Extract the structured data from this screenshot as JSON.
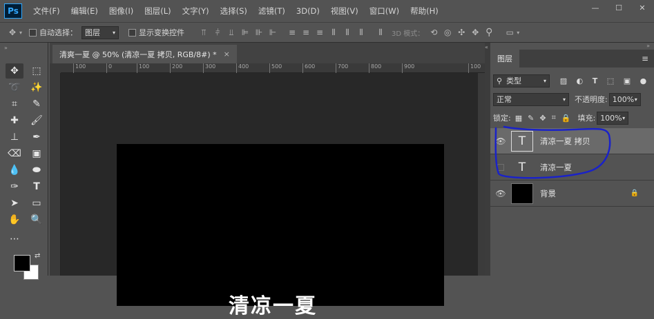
{
  "app": {
    "logo": "Ps"
  },
  "menu": [
    "文件(F)",
    "编辑(E)",
    "图像(I)",
    "图层(L)",
    "文字(Y)",
    "选择(S)",
    "滤镜(T)",
    "3D(D)",
    "视图(V)",
    "窗口(W)",
    "帮助(H)"
  ],
  "window_controls": {
    "minimize": "—",
    "maximize": "☐",
    "close": "✕"
  },
  "options": {
    "auto_select_label": "自动选择：",
    "auto_select_value": "图层",
    "show_transform_label": "显示变换控件",
    "mode_3d_label": "3D 模式："
  },
  "document": {
    "tab_title": "清爽一夏 @ 50% (清凉一夏 拷贝, RGB/8#) *",
    "close": "×",
    "ruler_ticks": [
      "100",
      "0",
      "100",
      "200",
      "300",
      "400",
      "500",
      "600",
      "700",
      "800",
      "900",
      "100"
    ],
    "canvas_text": "清凉一夏"
  },
  "layers_panel": {
    "tab_label": "图层",
    "filter_kind": "类型",
    "blend_mode": "正常",
    "opacity_label": "不透明度:",
    "opacity_value": "100%",
    "lock_label": "锁定:",
    "fill_label": "填充:",
    "fill_value": "100%",
    "layers": [
      {
        "name": "清凉一夏 拷贝",
        "type": "text",
        "visible": true,
        "selected": true
      },
      {
        "name": "清凉一夏",
        "type": "text",
        "visible": false,
        "selected": false
      },
      {
        "name": "背景",
        "type": "image",
        "visible": true,
        "selected": false,
        "locked": true
      }
    ]
  },
  "colors": {
    "ui_bg": "#535353",
    "canvas": "#000000",
    "annotation": "#1a22c8"
  }
}
